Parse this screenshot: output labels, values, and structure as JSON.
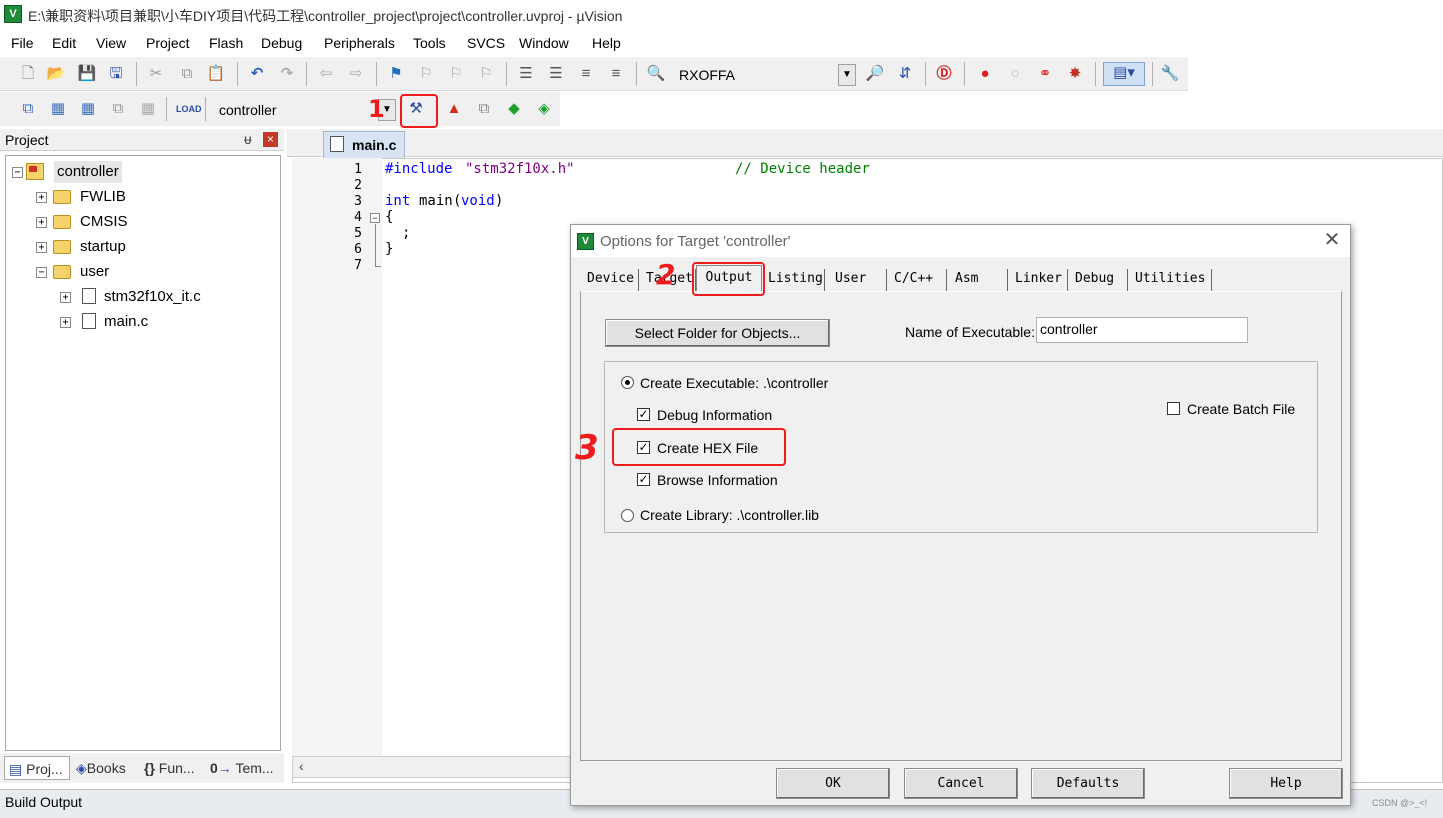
{
  "window": {
    "title": "E:\\兼职资料\\项目兼职\\小车DIY项目\\代码工程\\controller_project\\project\\controller.uvproj - µVision",
    "icon_letter": "V"
  },
  "menu": [
    "File",
    "Edit",
    "View",
    "Project",
    "Flash",
    "Debug",
    "Peripherals",
    "Tools",
    "SVCS",
    "Window",
    "Help"
  ],
  "toolbar1": {
    "find_combo_value": "RXOFFA"
  },
  "toolbar2": {
    "target_combo_value": "controller"
  },
  "project_panel": {
    "header": "Project",
    "pin": "ᵾ",
    "close": "×",
    "tree": {
      "root": "controller",
      "groups": [
        "FWLIB",
        "CMSIS",
        "startup",
        "user"
      ],
      "user_files": [
        "stm32f10x_it.c",
        "main.c"
      ]
    },
    "bottom_tabs": [
      "Proj...",
      "Books",
      "Fun...",
      "Tem..."
    ]
  },
  "editor": {
    "tab": "main.c",
    "line_numbers": [
      "1",
      "2",
      "3",
      "4",
      "5",
      "6",
      "7"
    ],
    "lines": {
      "l1_directive": "#include",
      "l1_string": "\"stm32f10x.h\"",
      "l1_comment": "// Device header",
      "l3_type": "int",
      "l3_name": "main",
      "l3_paren_open": "(",
      "l3_void": "void",
      "l3_paren_close": ")",
      "l4": "{",
      "l5": ";",
      "l6": "}"
    }
  },
  "build_output": {
    "label": "Build Output"
  },
  "dialog": {
    "title": "Options for Target 'controller'",
    "tabs": [
      "Device",
      "Target",
      "Output",
      "Listing",
      "User",
      "C/C++",
      "Asm",
      "Linker",
      "Debug",
      "Utilities"
    ],
    "active_tab": "Output",
    "select_folder_button": "Select Folder for Objects...",
    "name_of_executable_label": "Name of Executable:",
    "name_of_executable_value": "controller",
    "create_executable_label": "Create Executable:  .\\controller",
    "create_executable_selected": true,
    "debug_information_label": "Debug Information",
    "debug_information_checked": true,
    "create_hex_label": "Create HEX File",
    "create_hex_checked": true,
    "browse_information_label": "Browse Information",
    "browse_information_checked": true,
    "create_library_label": "Create Library:  .\\controller.lib",
    "create_library_selected": false,
    "create_batch_label": "Create Batch File",
    "create_batch_checked": false,
    "buttons": {
      "ok": "OK",
      "cancel": "Cancel",
      "defaults": "Defaults",
      "help": "Help"
    }
  },
  "annotations": {
    "step1": "1",
    "step2": "2",
    "step3": "3",
    "color": "#ee1c1c"
  },
  "watermark": "CSDN @>_<!",
  "colors": {
    "keyword_blue": "#0000ff",
    "comment_green": "#008000",
    "string_purple": "#800080",
    "active_tab_bg": "#d8e4f4"
  }
}
